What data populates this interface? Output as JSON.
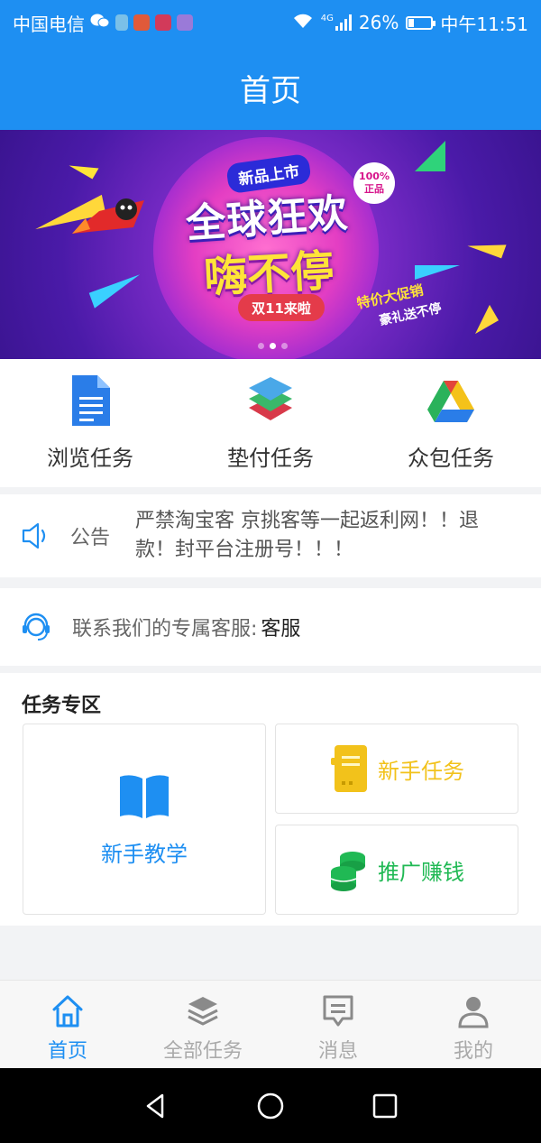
{
  "status_bar": {
    "carrier": "中国电信",
    "network": "4G",
    "battery": "26%",
    "battery_level": 0.26,
    "time": "中午11:51"
  },
  "header": {
    "title": "首页"
  },
  "banner": {
    "tag": "新品上市",
    "headline_1": "全球狂欢",
    "headline_2": "嗨不停",
    "badge_line1": "100%",
    "badge_line2": "正品",
    "pill": "双11来啦",
    "promo_1": "特价大促销",
    "promo_2": "豪礼送不停",
    "slides": 3,
    "active_slide": 1
  },
  "quick_nav": [
    {
      "label": "浏览任务",
      "icon": "document-icon"
    },
    {
      "label": "垫付任务",
      "icon": "layers-icon"
    },
    {
      "label": "众包任务",
      "icon": "drive-triangle-icon"
    }
  ],
  "notice": {
    "label": "公告",
    "text": "严禁淘宝客 京挑客等一起返利网！！退款！封平台注册号！！！"
  },
  "service": {
    "label": "联系我们的专属客服:",
    "link": "客服"
  },
  "task_zone": {
    "heading": "任务专区",
    "cards": {
      "tutorial": "新手教学",
      "newbie": "新手任务",
      "promote": "推广赚钱"
    },
    "colors": {
      "tutorial": "#1e8ff2",
      "newbie": "#f2c21b",
      "promote": "#20b954"
    }
  },
  "tabbar": [
    {
      "label": "首页",
      "icon": "home-icon",
      "active": true
    },
    {
      "label": "全部任务",
      "icon": "stack-icon",
      "active": false
    },
    {
      "label": "消息",
      "icon": "message-icon",
      "active": false
    },
    {
      "label": "我的",
      "icon": "user-icon",
      "active": false
    }
  ],
  "colors": {
    "accent": "#1e8ff2"
  }
}
